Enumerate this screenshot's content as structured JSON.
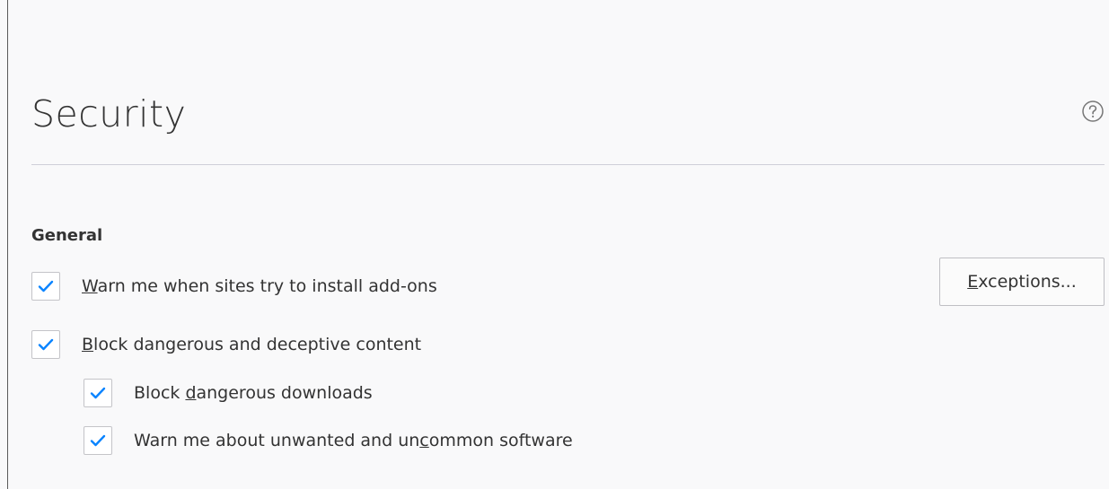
{
  "header": {
    "title": "Security",
    "help_icon": "question-circle-icon"
  },
  "general": {
    "heading": "General",
    "warn_addons": {
      "accesskey": "W",
      "rest": "arn me when sites try to install add-ons",
      "checked": true
    },
    "exceptions_button": {
      "accesskey": "E",
      "rest": "xceptions..."
    },
    "block_dangerous": {
      "accesskey": "B",
      "rest": "lock dangerous and deceptive content",
      "checked": true
    },
    "block_downloads": {
      "pre": "Block ",
      "accesskey": "d",
      "rest": "angerous downloads",
      "checked": true
    },
    "warn_unwanted": {
      "pre": "Warn me about unwanted and un",
      "accesskey": "c",
      "rest": "ommon software",
      "checked": true
    }
  },
  "colors": {
    "checkmark": "#0a84ff",
    "background": "#f9f9fa",
    "text": "#333333"
  }
}
